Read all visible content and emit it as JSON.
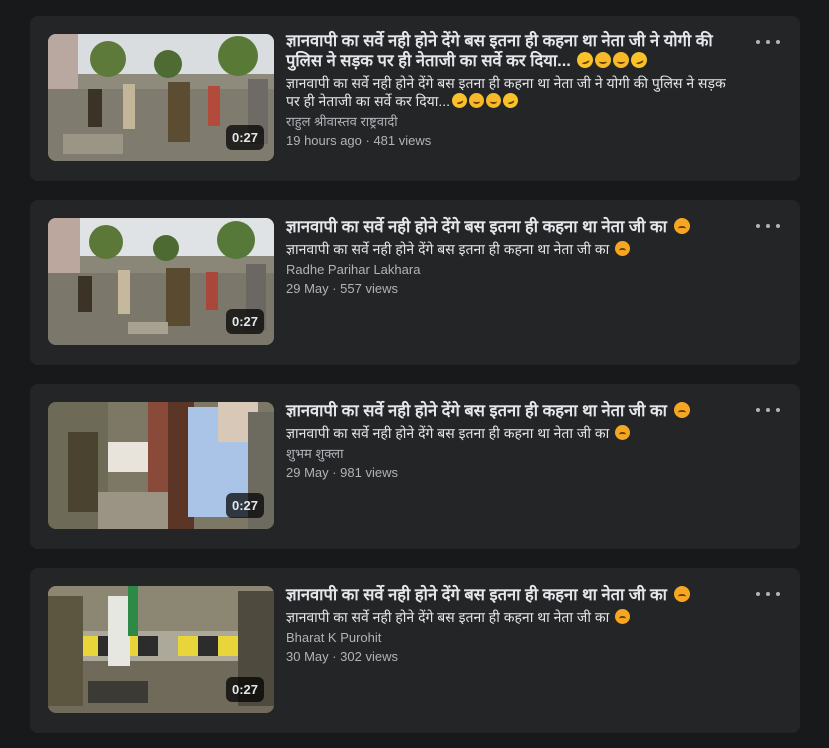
{
  "videos": [
    {
      "title": "ज्ञानवापी का सर्वे नही होने देंगे बस इतना ही कहना था नेता जी ने योगी की पुलिस ने सड़क पर ही नेताजी का सर्वे कर दिया...",
      "description": "ज्ञानवापी का सर्वे नही होने देंगे बस इतना ही कहना था नेता जी ने योगी की पुलिस ने सड़क पर ही नेताजी का सर्वे कर दिया...",
      "author": "राहुल श्रीवास्तव राष्ट्रवादी",
      "meta": "19 hours ago · 481 views",
      "duration": "0:27",
      "emoji": [
        "rolling-laughing-emoji",
        "upside-down-face-emoji",
        "grinning-emoji",
        "laughing-emoji"
      ]
    },
    {
      "title": "ज्ञानवापी का सर्वे नही होने देंगे बस इतना ही कहना था नेता जी का",
      "description": "ज्ञानवापी का सर्वे नही होने देंगे बस इतना ही कहना था नेता जी का",
      "author": "Radhe Parihar Lakhara",
      "meta": "29 May · 557 views",
      "duration": "0:27",
      "emoji": [
        "disappointed-emoji"
      ]
    },
    {
      "title": "ज्ञानवापी का सर्वे नही होने देंगे बस इतना ही कहना था नेता जी का",
      "description": "ज्ञानवापी का सर्वे नही होने देंगे बस इतना ही कहना था नेता जी का",
      "author": "शुभम शुक्ला",
      "meta": "29 May · 981 views",
      "duration": "0:27",
      "emoji": [
        "disappointed-emoji"
      ]
    },
    {
      "title": "ज्ञानवापी का सर्वे नही होने देंगे बस इतना ही कहना था नेता जी का",
      "description": "ज्ञानवापी का सर्वे नही होने देंगे बस इतना ही कहना था नेता जी का",
      "author": "Bharat K Purohit",
      "meta": "30 May · 302 views",
      "duration": "0:27",
      "emoji": [
        "disappointed-emoji"
      ]
    }
  ],
  "colors": {
    "page_background": "#18191a",
    "card_background": "#242526",
    "primary_text": "#e4e6eb",
    "secondary_text": "#b0b3b8"
  }
}
